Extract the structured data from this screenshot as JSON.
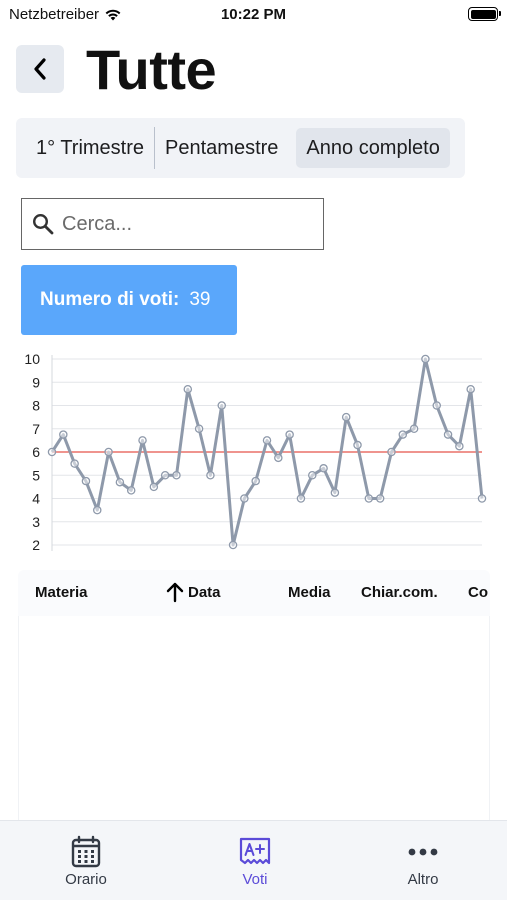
{
  "status_bar": {
    "carrier": "Netzbetreiber",
    "time": "10:22 PM"
  },
  "header": {
    "title": "Tutte"
  },
  "period_tabs": [
    {
      "label": "1° Trimestre",
      "selected": false
    },
    {
      "label": "Pentamestre",
      "selected": false
    },
    {
      "label": "Anno completo",
      "selected": true
    }
  ],
  "search": {
    "placeholder": "Cerca...",
    "value": ""
  },
  "vote_count": {
    "label": "Numero di voti:",
    "value": "39",
    "color": "#5aa7fb"
  },
  "chart_data": {
    "type": "line",
    "ylim": [
      2,
      10
    ],
    "y_ticks": [
      "2",
      "3",
      "4",
      "5",
      "6",
      "7",
      "8",
      "9",
      "10"
    ],
    "grid": true,
    "reference_line": 6,
    "reference_line_color": "#e5534b",
    "series_color": "#8e99aa",
    "series": [
      {
        "values": [
          6,
          6.75,
          5.5,
          4.75,
          3.5,
          6,
          4.7,
          4.35,
          6.5,
          4.5,
          5,
          5,
          8.7,
          7,
          5,
          8,
          2,
          4,
          4.75,
          6.5,
          5.75,
          6.75,
          4,
          5,
          5.3,
          4.25,
          7.5,
          6.3,
          4,
          4,
          6,
          6.75,
          7,
          10,
          8,
          6.75,
          6.25,
          8.7,
          4
        ]
      }
    ]
  },
  "table": {
    "columns": [
      "Materia",
      "Data",
      "Media",
      "Chiar.com.",
      "Co"
    ],
    "sorted_column": "Data",
    "rows": []
  },
  "tab_bar": {
    "items": [
      {
        "label": "Orario",
        "icon": "calendar-icon",
        "active": false
      },
      {
        "label": "Voti",
        "icon": "grade-icon",
        "active": true
      },
      {
        "label": "Altro",
        "icon": "more-icon",
        "active": false
      }
    ],
    "active_color": "#5b4bd8"
  }
}
